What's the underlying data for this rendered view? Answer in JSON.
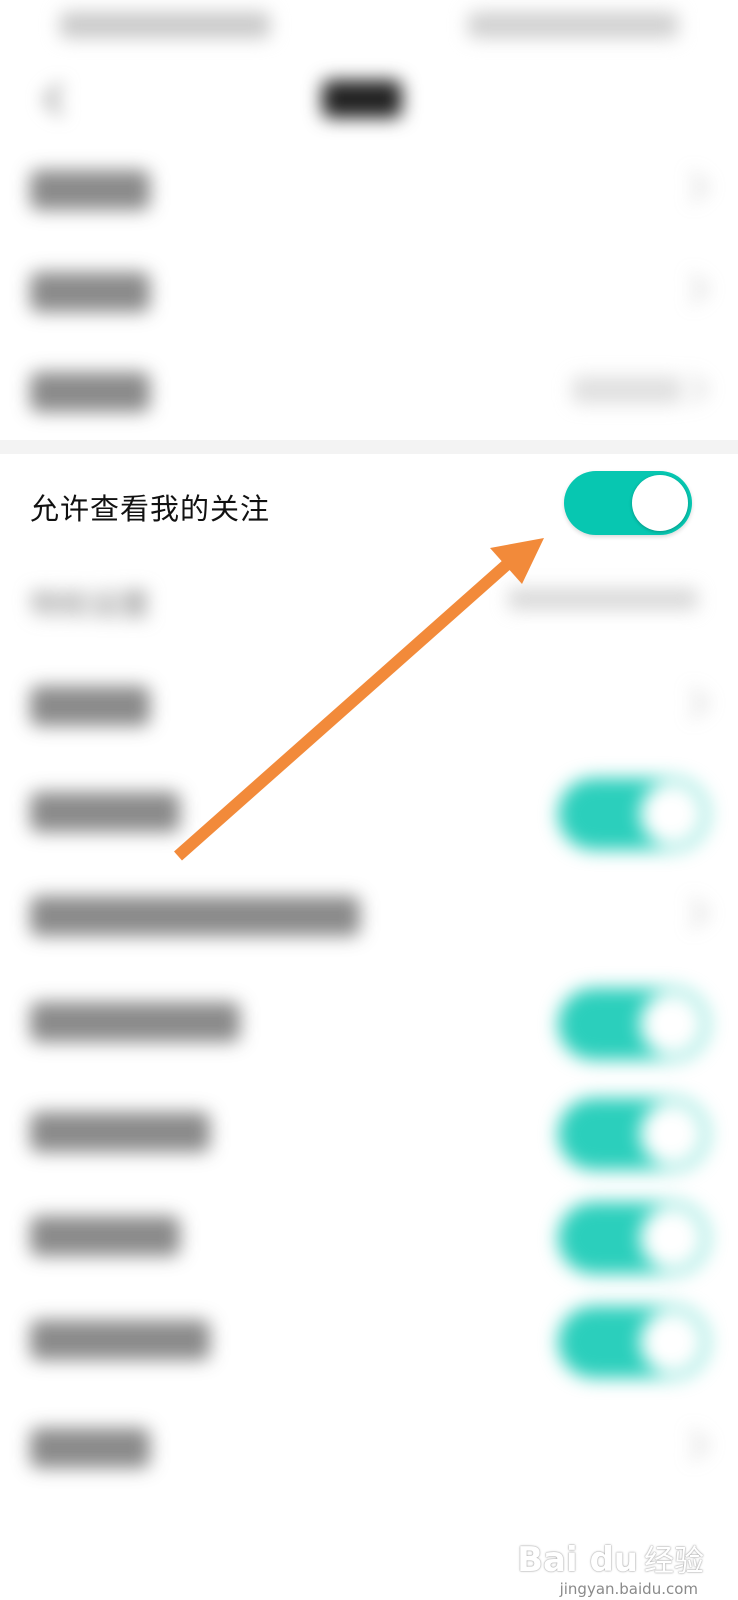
{
  "settings": {
    "allow_view_following": {
      "label": "允许查看我的关注",
      "enabled": true
    },
    "section_title": "特权设置"
  },
  "colors": {
    "accent": "#07c7b1",
    "arrow": "#f28a3a"
  },
  "watermark": {
    "logo": "Bai du",
    "text": "经验",
    "url": "jingyan.baidu.com"
  }
}
